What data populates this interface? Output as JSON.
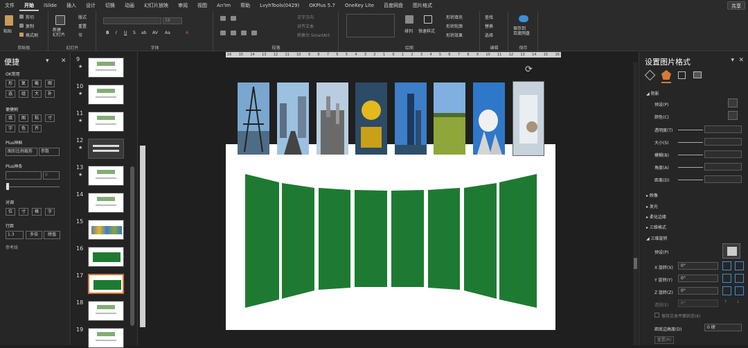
{
  "tabs": [
    "文件",
    "开始",
    "iSlide",
    "插入",
    "设计",
    "切换",
    "动画",
    "幻灯片放映",
    "审阅",
    "视图",
    "An'Im",
    "帮助",
    "LvyhTools(0429)",
    "OKPlus 5.7",
    "OneKey Lite",
    "百度网盘",
    "图片格式"
  ],
  "active_tab": "开始",
  "share_label": "共享",
  "ribbon": {
    "clipboard": {
      "paste": "粘贴",
      "cut": "剪切",
      "copy": "复制",
      "format_painter": "格式刷",
      "group": "剪贴板"
    },
    "slides": {
      "new_slide": "新建\n幻灯片",
      "layout": "版式",
      "reset": "重置",
      "section": "节",
      "group": "幻灯片"
    },
    "font": {
      "group": "字体",
      "size_value": "18"
    },
    "paragraph": {
      "text_direction": "文字方向",
      "align_text": "对齐文本",
      "smartart": "转换为 SmartArt",
      "group": "段落"
    },
    "drawing": {
      "arrange": "排列",
      "quick_styles": "快速样式",
      "shape_fill": "形状填充",
      "shape_outline": "形状轮廓",
      "shape_effects": "形状效果",
      "group": "绘图"
    },
    "editing": {
      "find": "查找",
      "replace": "替换",
      "select": "选择",
      "group": "编辑"
    },
    "save": {
      "save_to": "保存到\n百度网盘",
      "group": "保存"
    }
  },
  "left_panel": {
    "title": "便捷",
    "ok_label": "OK常用",
    "ok_buttons": [
      "形",
      "复",
      "截",
      "图",
      "选",
      "组",
      "大",
      "补"
    ],
    "brush_label": "便捷刷",
    "brush_buttons": [
      "填",
      "图",
      "粘",
      "寸",
      "字",
      "色",
      "齐"
    ],
    "plus_frame_label": "Plus神框",
    "frame_value": "图形比例裁剪",
    "frame_param": "参数",
    "plus_bar_label": "Plus神条",
    "bar_value": "0",
    "align_label": "对调",
    "align_buttons": [
      "位",
      "寸",
      "格",
      "字"
    ],
    "line_label": "行距",
    "line_value": "1.3",
    "line_multi": "多倍",
    "line_exact": "磅值",
    "ref_label": "参考线"
  },
  "thumbnails": [
    {
      "num": "9",
      "star": "★"
    },
    {
      "num": "10",
      "star": "★"
    },
    {
      "num": "11",
      "star": "★"
    },
    {
      "num": "12",
      "star": "★"
    },
    {
      "num": "13",
      "star": "★"
    },
    {
      "num": "14",
      "star": ""
    },
    {
      "num": "15",
      "star": ""
    },
    {
      "num": "16",
      "star": ""
    },
    {
      "num": "17",
      "star": ""
    },
    {
      "num": "18",
      "star": ""
    },
    {
      "num": "19",
      "star": ""
    }
  ],
  "ruler_labels": [
    "16",
    "15",
    "14",
    "13",
    "12",
    "11",
    "10",
    "9",
    "8",
    "7",
    "6",
    "5",
    "4",
    "3",
    "2",
    "1",
    "0",
    "1",
    "2",
    "3",
    "4",
    "5",
    "6",
    "7",
    "8",
    "9",
    "10",
    "11",
    "12",
    "13",
    "14",
    "15",
    "16"
  ],
  "format_panel": {
    "title": "设置图片格式",
    "shadow": "阴影",
    "preset": "预设(P)",
    "color": "颜色(C)",
    "transparency": "透明度(T)",
    "size": "大小(S)",
    "blur": "模糊(B)",
    "angle": "角度(A)",
    "distance": "距离(D)",
    "reflection": "映像",
    "glow": "发光",
    "soft_edges": "柔化边缘",
    "format_3d": "三维格式",
    "rotation_3d": "三维旋转",
    "preset2": "预设(P)",
    "x_rot": "X 旋转(X)",
    "y_rot": "Y 旋转(Y)",
    "z_rot": "Z 旋转(Z)",
    "x_val": "0°",
    "y_val": "0°",
    "z_val": "0°",
    "perspective": "透视(E)",
    "perspective_val": "0°",
    "keep_flat": "保持文本平面状态(K)",
    "dist_ground": "距底边高度(D)",
    "dist_val": "0 磅",
    "reset": "重置(R)"
  },
  "colors": {
    "accent": "#1e7a32",
    "selected_border": "#d57a3a"
  }
}
